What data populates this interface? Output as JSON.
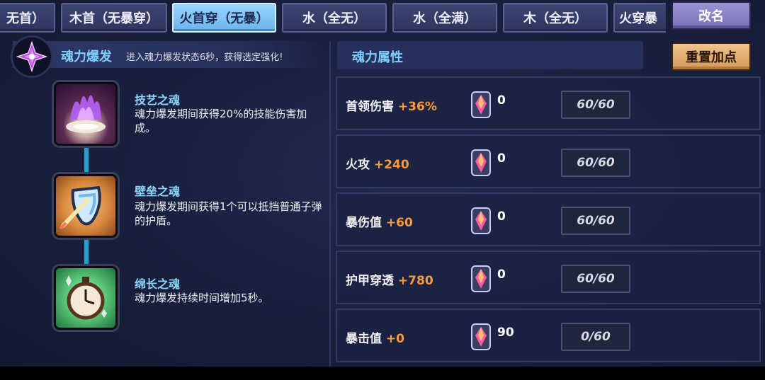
{
  "tabs": [
    {
      "label": "无首）",
      "active": false
    },
    {
      "label": "木首（无暴穿）",
      "active": false
    },
    {
      "label": "火首穿（无暴）",
      "active": true
    },
    {
      "label": "水（全无）",
      "active": false
    },
    {
      "label": "水（全满）",
      "active": false
    },
    {
      "label": "木（全无）",
      "active": false
    },
    {
      "label": "火穿暴",
      "active": false
    }
  ],
  "rename_button": "改名",
  "soul_burst": {
    "title": "魂力爆发",
    "description": "进入魂力爆发状态6秒，获得选定强化!"
  },
  "skills": [
    {
      "name": "技艺之魂",
      "description": "魂力爆发期间获得20%的技能伤害加成。",
      "icon": "purple-flame-hand-icon"
    },
    {
      "name": "壁垒之魂",
      "description": "魂力爆发期间获得1个可以抵挡普通子弹的护盾。",
      "icon": "shield-icon"
    },
    {
      "name": "绵长之魂",
      "description": "魂力爆发持续时间增加5秒。",
      "icon": "stopwatch-icon"
    }
  ],
  "attributes_panel": {
    "title": "魂力属性",
    "reset_button": "重置加点",
    "rows": [
      {
        "label": "首领伤害",
        "bonus": "+36%",
        "gem_count": "0",
        "progress": "60/60"
      },
      {
        "label": "火攻",
        "bonus": "+240",
        "gem_count": "0",
        "progress": "60/60"
      },
      {
        "label": "暴伤值",
        "bonus": "+60",
        "gem_count": "0",
        "progress": "60/60"
      },
      {
        "label": "护甲穿透",
        "bonus": "+780",
        "gem_count": "0",
        "progress": "60/60"
      },
      {
        "label": "暴击值",
        "bonus": "+0",
        "gem_count": "90",
        "progress": "0/60"
      }
    ]
  },
  "colors": {
    "accent_blue": "#7fd0ff",
    "bonus_orange": "#ff9a3a",
    "active_tab": "#8fcdf8",
    "reset_button": "#e6b177",
    "rename_button": "#8b84c6"
  }
}
